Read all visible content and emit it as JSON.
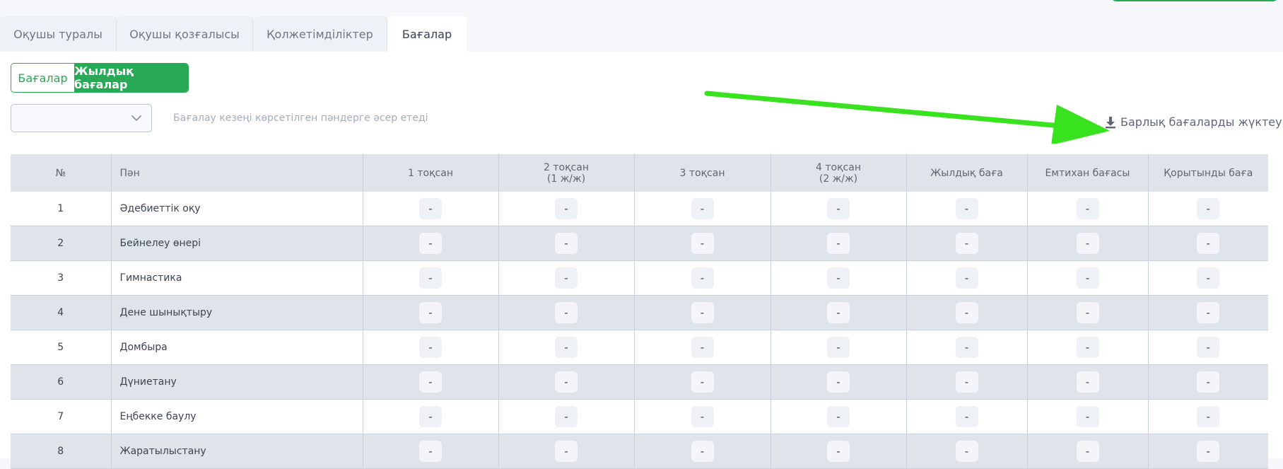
{
  "tabs": [
    {
      "label": "Оқушы туралы",
      "active": false
    },
    {
      "label": "Оқушы қозғалысы",
      "active": false
    },
    {
      "label": "Қолжетімділіктер",
      "active": false
    },
    {
      "label": "Бағалар",
      "active": true
    }
  ],
  "segments": {
    "grades": "Бағалар",
    "annual_grades": "Жылдық бағалар",
    "active": "annual_grades"
  },
  "period_select": {
    "value": "",
    "icon": "chevron-down-icon"
  },
  "period_hint": "Бағалау кезеңі көрсетілген пәндерге әсер етеді",
  "download_all": {
    "label": "Барлық бағаларды жүктеу",
    "icon": "download-icon"
  },
  "annotation": {
    "color": "#39e21e"
  },
  "colors": {
    "accent": "#27a955",
    "header_bg": "#dfe4eb"
  },
  "table": {
    "headers": [
      "№",
      "Пән",
      "1 тоқсан",
      "2 тоқсан\n(1 ж/ж)",
      "3 тоқсан",
      "4 тоқсан\n(2 ж/ж)",
      "Жылдық баға",
      "Емтихан бағасы",
      "Қорытынды баға"
    ],
    "rows": [
      {
        "num": "1",
        "subject": "Әдебиеттік оқу",
        "grades": [
          "-",
          "-",
          "-",
          "-",
          "-",
          "-",
          "-"
        ]
      },
      {
        "num": "2",
        "subject": "Бейнелеу өнері",
        "grades": [
          "-",
          "-",
          "-",
          "-",
          "-",
          "-",
          "-"
        ]
      },
      {
        "num": "3",
        "subject": "Гимнастика",
        "grades": [
          "-",
          "-",
          "-",
          "-",
          "-",
          "-",
          "-"
        ]
      },
      {
        "num": "4",
        "subject": "Дене шынықтыру",
        "grades": [
          "-",
          "-",
          "-",
          "-",
          "-",
          "-",
          "-"
        ]
      },
      {
        "num": "5",
        "subject": "Домбыра",
        "grades": [
          "-",
          "-",
          "-",
          "-",
          "-",
          "-",
          "-"
        ]
      },
      {
        "num": "6",
        "subject": "Дүниетану",
        "grades": [
          "-",
          "-",
          "-",
          "-",
          "-",
          "-",
          "-"
        ]
      },
      {
        "num": "7",
        "subject": "Еңбекке баулу",
        "grades": [
          "-",
          "-",
          "-",
          "-",
          "-",
          "-",
          "-"
        ]
      },
      {
        "num": "8",
        "subject": "Жаратылыстану",
        "grades": [
          "-",
          "-",
          "-",
          "-",
          "-",
          "-",
          "-"
        ]
      }
    ]
  }
}
